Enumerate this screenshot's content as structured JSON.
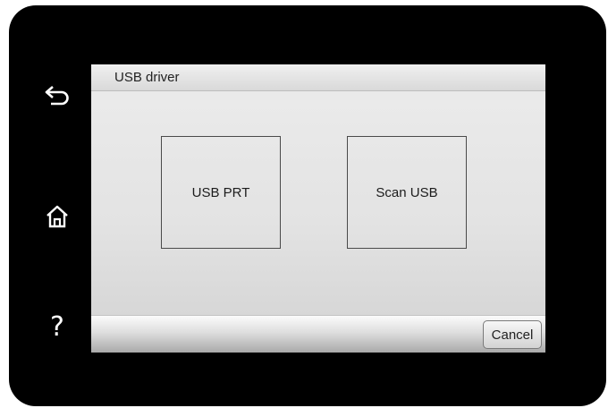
{
  "side_buttons": {
    "back_icon": "back-arrow-icon",
    "home_icon": "home-icon",
    "help_icon": "question-mark-icon",
    "help_glyph": "?"
  },
  "screen": {
    "title": "USB driver",
    "options": [
      {
        "label": "USB PRT"
      },
      {
        "label": "Scan USB"
      }
    ],
    "cancel_label": "Cancel"
  },
  "colors": {
    "bezel": "#000000",
    "screen_background": "#e3e3e3",
    "tile_border": "#4a4a4a",
    "text": "#222222"
  }
}
